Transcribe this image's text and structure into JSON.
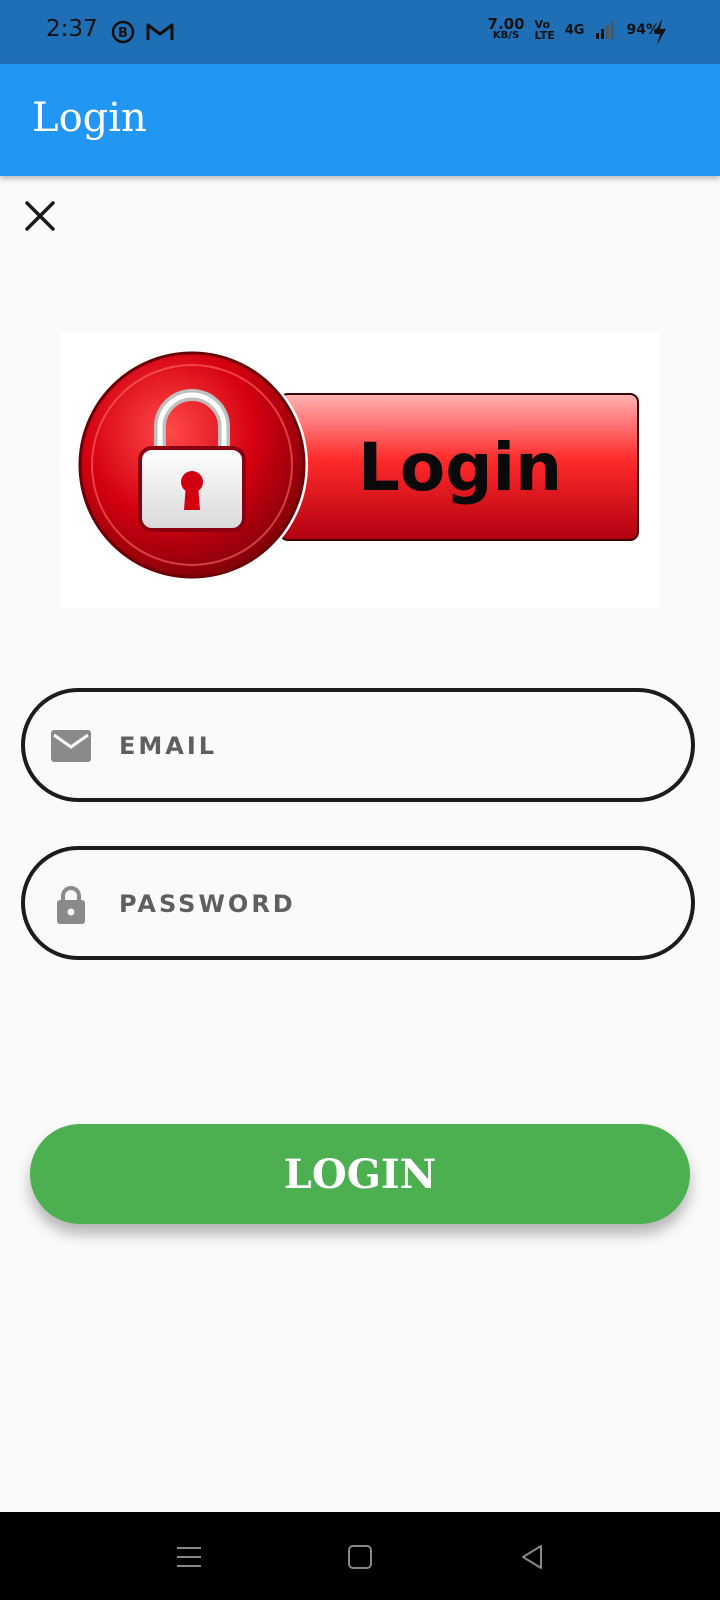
{
  "status_bar": {
    "time": "2:37",
    "net_speed_value": "7.00",
    "net_speed_unit": "KB/S",
    "volte_top": "Vo",
    "volte_bottom": "LTE",
    "network": "4G",
    "battery": "94%",
    "icons": [
      "b-notification-icon",
      "gmail-icon",
      "signal-icon",
      "charging-bolt-icon"
    ]
  },
  "app_bar": {
    "title": "Login"
  },
  "banner": {
    "text": "Login",
    "icon": "padlock-icon"
  },
  "form": {
    "email_placeholder": "EMAIL",
    "email_value": "",
    "password_placeholder": "PASSWORD",
    "password_value": "",
    "login_label": "LOGIN"
  },
  "colors": {
    "status_bar": "#1f6fb6",
    "app_bar": "#2196f3",
    "login_button": "#4caf50",
    "banner_red": "#e0001a",
    "background": "#fafafa"
  },
  "nav_bar": {
    "icons": [
      "recents-icon",
      "home-icon",
      "back-icon"
    ]
  }
}
